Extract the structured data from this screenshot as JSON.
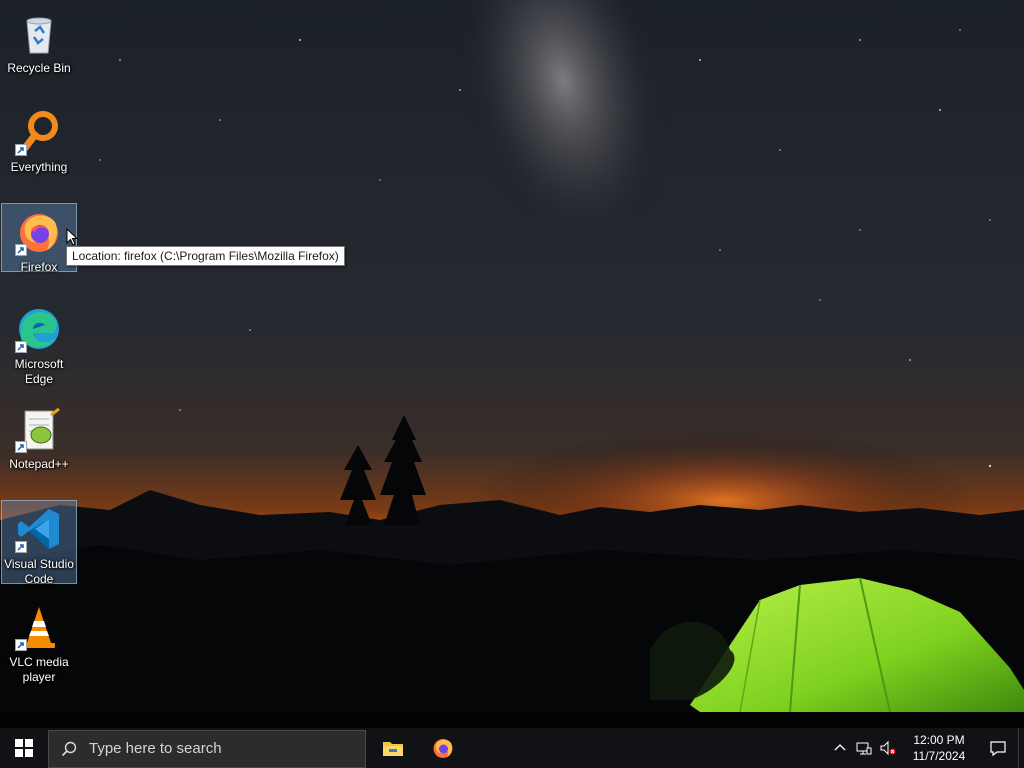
{
  "desktop": {
    "icons": [
      {
        "label": "Recycle Bin",
        "icon": "recycle-bin-icon"
      },
      {
        "label": "Everything",
        "icon": "everything-icon"
      },
      {
        "label": "Firefox",
        "icon": "firefox-icon",
        "selected": true
      },
      {
        "label": "Microsoft Edge",
        "icon": "edge-icon"
      },
      {
        "label": "Notepad++",
        "icon": "notepad-plus-plus-icon"
      },
      {
        "label": "Visual Studio Code",
        "icon": "vscode-icon",
        "selected": true
      },
      {
        "label": "VLC media player",
        "icon": "vlc-icon"
      }
    ],
    "tooltip": "Location: firefox (C:\\Program Files\\Mozilla Firefox)"
  },
  "taskbar": {
    "search_placeholder": "Type here to search",
    "pinned_apps": [
      "file-explorer-icon",
      "firefox-icon"
    ],
    "tray_icons": [
      "chevron-up-icon",
      "network-icon",
      "volume-muted-icon"
    ],
    "clock": {
      "time": "12:00 PM",
      "date": "11/7/2024"
    },
    "notification_icon": "action-center-icon"
  },
  "colors": {
    "taskbar_bg": "#101216",
    "selection_bg": "#5e83af",
    "tent_green": "#8cd92b",
    "horizon_orange": "#e0601c"
  }
}
